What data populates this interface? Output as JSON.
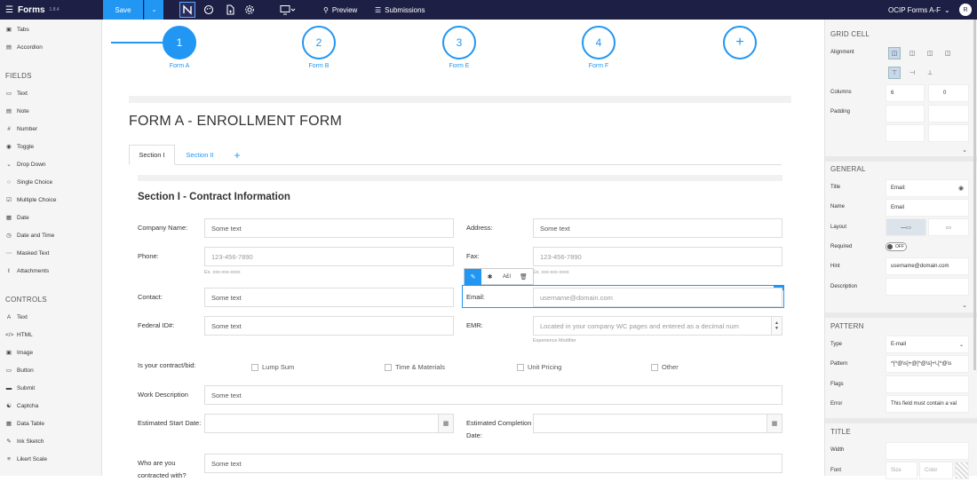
{
  "topbar": {
    "app_name": "Forms",
    "version": "1.8.4",
    "save_label": "Save",
    "preview_label": "Preview",
    "submissions_label": "Submissions",
    "form_selector": "OCIP Forms A-F",
    "user_initial": "R"
  },
  "left_sidebar": {
    "layout_items": [
      {
        "icon": "tabs-icon",
        "label": "Tabs"
      },
      {
        "icon": "accordion-icon",
        "label": "Accordion"
      }
    ],
    "fields_heading": "FIELDS",
    "fields": [
      {
        "icon": "text-icon",
        "label": "Text"
      },
      {
        "icon": "note-icon",
        "label": "Note"
      },
      {
        "icon": "number-icon",
        "label": "Number"
      },
      {
        "icon": "toggle-icon",
        "label": "Toggle"
      },
      {
        "icon": "dropdown-icon",
        "label": "Drop Down"
      },
      {
        "icon": "single-choice-icon",
        "label": "Single Choice"
      },
      {
        "icon": "multiple-choice-icon",
        "label": "Multiple Choice"
      },
      {
        "icon": "date-icon",
        "label": "Date"
      },
      {
        "icon": "date-time-icon",
        "label": "Date and Time"
      },
      {
        "icon": "masked-text-icon",
        "label": "Masked Text"
      },
      {
        "icon": "attachments-icon",
        "label": "Attachments"
      }
    ],
    "controls_heading": "CONTROLS",
    "controls": [
      {
        "icon": "text-control-icon",
        "label": "Text"
      },
      {
        "icon": "html-icon",
        "label": "HTML"
      },
      {
        "icon": "image-icon",
        "label": "Image"
      },
      {
        "icon": "button-icon",
        "label": "Button"
      },
      {
        "icon": "submit-icon",
        "label": "Submit"
      },
      {
        "icon": "captcha-icon",
        "label": "Captcha"
      },
      {
        "icon": "data-table-icon",
        "label": "Data Table"
      },
      {
        "icon": "ink-sketch-icon",
        "label": "Ink Sketch"
      },
      {
        "icon": "likert-scale-icon",
        "label": "Likert Scale"
      }
    ]
  },
  "steps": [
    {
      "number": "1",
      "label": "Form A",
      "active": true
    },
    {
      "number": "2",
      "label": "Form B",
      "active": false
    },
    {
      "number": "3",
      "label": "Form E",
      "active": false
    },
    {
      "number": "4",
      "label": "Form F",
      "active": false
    },
    {
      "number": "+",
      "label": "",
      "active": false
    }
  ],
  "form": {
    "title": "FORM A - ENROLLMENT FORM",
    "tabs": [
      "Section I",
      "Section II"
    ],
    "section_title": "Section I - Contract Information",
    "fields": {
      "company_name": {
        "label": "Company Name:",
        "value": "Some text"
      },
      "address": {
        "label": "Address:",
        "value": "Some text"
      },
      "phone": {
        "label": "Phone:",
        "placeholder": "123-456-7890",
        "hint": "Ex. xxx-xxx-xxxx"
      },
      "fax": {
        "label": "Fax:",
        "placeholder": "123-456-7890",
        "hint": "Ex. xxx-xxx-xxxx"
      },
      "contact": {
        "label": "Contact:",
        "value": "Some text"
      },
      "email": {
        "label": "Email:",
        "placeholder": "username@domain.com"
      },
      "federal_id": {
        "label": "Federal ID#:",
        "value": "Some text"
      },
      "emr": {
        "label": "EMR:",
        "placeholder": "Located in your company WC pages and entered as a decimal num",
        "hint": "Experience Modifier"
      },
      "contract_bid": {
        "label": "Is your contract/bid:",
        "options": [
          "Lump Sum",
          "Time & Materials",
          "Unit Pricing",
          "Other"
        ]
      },
      "work_description": {
        "label": "Work Description",
        "value": "Some text"
      },
      "est_start": {
        "label": "Estimated Start Date:"
      },
      "est_completion": {
        "label": "Estimated Completion Date:"
      },
      "contracted_with": {
        "label": "Who are you contracted with?",
        "value": "Some text"
      }
    },
    "element_toolbar": {
      "code_label": "A£I"
    }
  },
  "right_sidebar": {
    "grid_cell_heading": "GRID CELL",
    "alignment_label": "Alignment",
    "columns_label": "Columns",
    "columns_value": "6",
    "columns_offset": "0",
    "padding_label": "Padding",
    "general_heading": "GENERAL",
    "title_label": "Title",
    "title_value": "Email:",
    "name_label": "Name",
    "name_value": "Email",
    "layout_label": "Layout",
    "required_label": "Required",
    "required_value": "OFF",
    "hint_label": "Hint",
    "hint_value": "username@domain.com",
    "description_label": "Description",
    "pattern_heading": "PATTERN",
    "type_label": "Type",
    "type_value": "E-mail",
    "pattern_label": "Pattern",
    "pattern_value": "^[^@\\s]+@[^@\\s]+\\.[^@\\s",
    "flags_label": "Flags",
    "error_label": "Error",
    "error_value": "This field must contain a val",
    "title_heading": "TITLE",
    "width_label": "Width",
    "font_label": "Font",
    "font_size_placeholder": "Size",
    "font_color_placeholder": "Color"
  }
}
